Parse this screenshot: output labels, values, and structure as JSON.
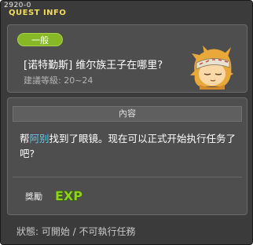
{
  "window": {
    "id": "2920-0",
    "title": "QUEST INFO"
  },
  "quest": {
    "category": "一般",
    "name": "[诺特勤斯] 维尔族王子在哪里?",
    "level_label": "建議等級:",
    "level_value": "20~24"
  },
  "npc": {
    "icon": "npc-portrait-icon"
  },
  "content": {
    "header": "內容",
    "text_prefix": "帮",
    "highlight": "阿别",
    "text_suffix": "找到了眼镜。现在可以正式开始执行任务了吧?"
  },
  "reward": {
    "label": "獎勵",
    "icon_text": "EXP"
  },
  "status": {
    "text": "狀態: 可開始 / 不可執行任務"
  },
  "colors": {
    "title": "#f2dc5a",
    "badge": "#86b925",
    "highlight": "#5fc7f0",
    "exp": "#8ed21a"
  }
}
